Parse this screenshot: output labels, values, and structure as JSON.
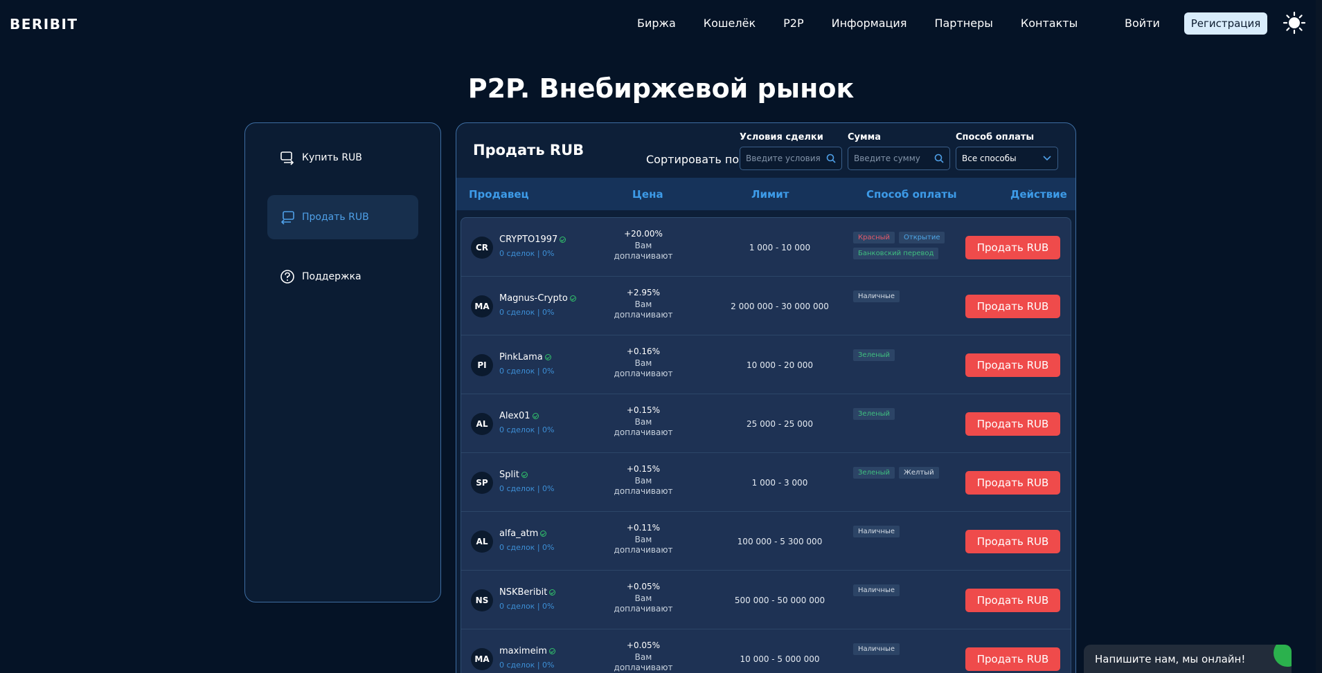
{
  "header": {
    "logo": "BERIBIT",
    "nav": [
      "Биржа",
      "Кошелёк",
      "P2P",
      "Информация",
      "Партнеры",
      "Контакты"
    ],
    "login": "Войти",
    "register": "Регистрация",
    "theme_icon": "sun-icon"
  },
  "page_title": "P2P. Внебиржевой рынок",
  "sidebar": {
    "items": [
      {
        "label": "Купить RUB",
        "icon": "buy-icon"
      },
      {
        "label": "Продать RUB",
        "icon": "sell-icon",
        "active": true
      },
      {
        "label": "Поддержка",
        "icon": "help-icon"
      }
    ]
  },
  "panel": {
    "title": "Продать RUB",
    "sort_label": "Сортировать по:",
    "filters": {
      "conditions_label": "Условия сделки",
      "conditions_placeholder": "Введите условия",
      "amount_label": "Сумма",
      "amount_placeholder": "Введите сумму",
      "payment_label": "Способ оплаты",
      "payment_value": "Все способы"
    },
    "columns": [
      "Продавец",
      "Цена",
      "Лимит",
      "Способ оплаты",
      "Действие"
    ],
    "price_note": "Вам доплачивают",
    "action_label": "Продать RUB",
    "rows": [
      {
        "initials": "CR",
        "name": "CRYPTO1997",
        "stats": "0 сделок | 0%",
        "price": "+20.00%",
        "limit": "1 000 - 10 000",
        "methods": [
          "Красный",
          "Открытие",
          "Банковский перевод"
        ]
      },
      {
        "initials": "MA",
        "name": "Magnus-Crypto",
        "stats": "0 сделок | 0%",
        "price": "+2.95%",
        "limit": "2 000 000 - 30 000 000",
        "methods": [
          "Наличные"
        ]
      },
      {
        "initials": "PI",
        "name": "PinkLama",
        "stats": "0 сделок | 0%",
        "price": "+0.16%",
        "limit": "10 000 - 20 000",
        "methods": [
          "Зеленый"
        ]
      },
      {
        "initials": "AL",
        "name": "Alex01",
        "stats": "0 сделок | 0%",
        "price": "+0.15%",
        "limit": "25 000 - 25 000",
        "methods": [
          "Зеленый"
        ]
      },
      {
        "initials": "SP",
        "name": "Split",
        "stats": "0 сделок | 0%",
        "price": "+0.15%",
        "limit": "1 000 - 3 000",
        "methods": [
          "Зеленый",
          "Желтый"
        ]
      },
      {
        "initials": "AL",
        "name": "alfa_atm",
        "stats": "0 сделок | 0%",
        "price": "+0.11%",
        "limit": "100 000 - 5 300 000",
        "methods": [
          "Наличные"
        ]
      },
      {
        "initials": "NS",
        "name": "NSKBeribit",
        "stats": "0 сделок | 0%",
        "price": "+0.05%",
        "limit": "500 000 - 50 000 000",
        "methods": [
          "Наличные"
        ]
      },
      {
        "initials": "MA",
        "name": "maximeim",
        "stats": "0 сделок | 0%",
        "price": "+0.05%",
        "limit": "10 000 - 5 000 000",
        "methods": [
          "Наличные"
        ]
      }
    ]
  },
  "tag_colors": {
    "Красный": "#e55a6a",
    "Открытие": "#4ea7e8",
    "Банковский перевод": "#3fbf7f",
    "Наличные": "#d6dde6",
    "Зеленый": "#3fbf7f",
    "Желтый": "#d6dde6"
  },
  "chat": {
    "text": "Напишите нам, мы онлайн!"
  }
}
